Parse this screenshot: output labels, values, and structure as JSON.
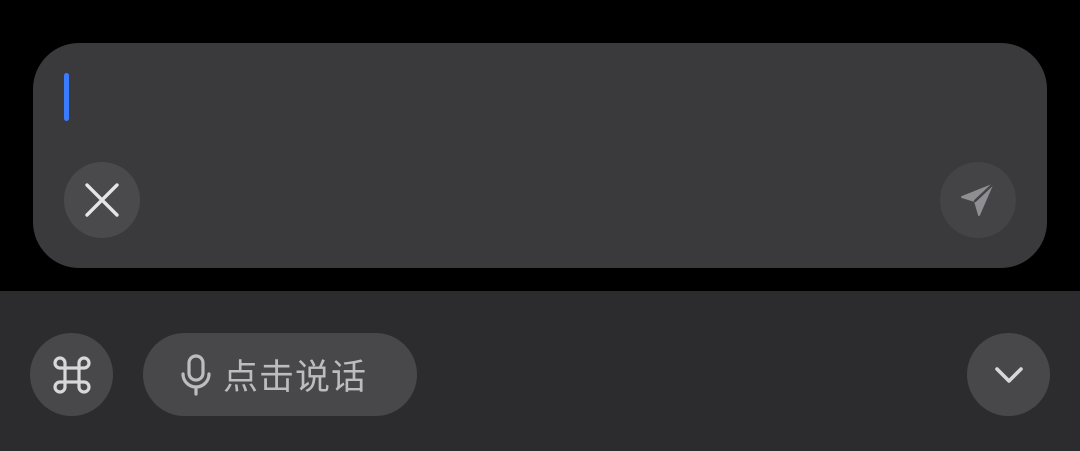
{
  "composer": {
    "text_value": "",
    "placeholder": "",
    "caret_color": "#3b7cff",
    "close_button_icon": "close-icon",
    "send_button_icon": "paper-plane-icon"
  },
  "toolbar": {
    "apps_button_icon": "command-icon",
    "voice_button": {
      "icon": "microphone-icon",
      "label": "点击说话"
    },
    "collapse_button_icon": "chevron-down-icon"
  },
  "colors": {
    "background": "#000000",
    "card": "#3a3a3c",
    "toolbar": "#2c2c2e",
    "button": "#48484a",
    "icon": "#d8d8da",
    "send_icon_disabled": "#8e8e93"
  }
}
